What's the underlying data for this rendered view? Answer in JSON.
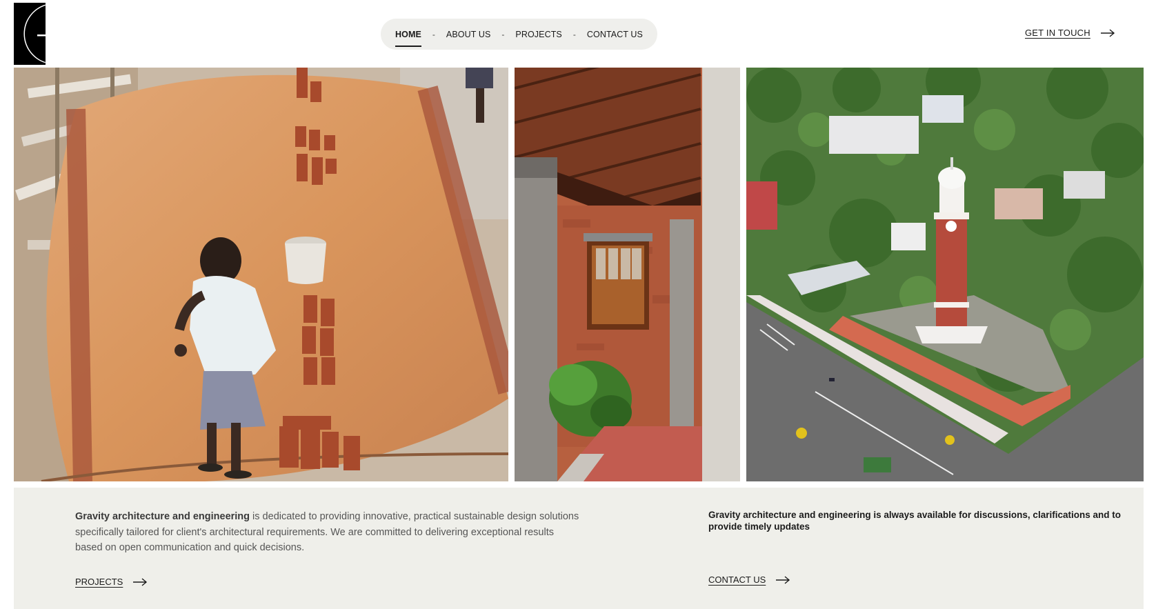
{
  "nav": {
    "items": [
      {
        "label": "HOME",
        "active": true
      },
      {
        "label": "ABOUT US",
        "active": false
      },
      {
        "label": "PROJECTS",
        "active": false
      },
      {
        "label": "CONTACT US",
        "active": false
      }
    ],
    "separator": "-",
    "cta_label": "GET IN TOUCH"
  },
  "info": {
    "left_bold": "Gravity architecture and engineering",
    "left_text": " is dedicated to providing innovative, practical sustainable design solutions specifically tailored for client's architectural requirements. We are committed to delivering exceptional results based on open communication and quick decisions.",
    "left_link": "PROJECTS",
    "right_text": "Gravity architecture and engineering is always available for discussions, clarifications and to provide timely updates",
    "right_link": "CONTACT US"
  },
  "colors": {
    "pill_bg": "#efefec",
    "band_bg": "#efefea",
    "text": "#1a1a1a"
  }
}
